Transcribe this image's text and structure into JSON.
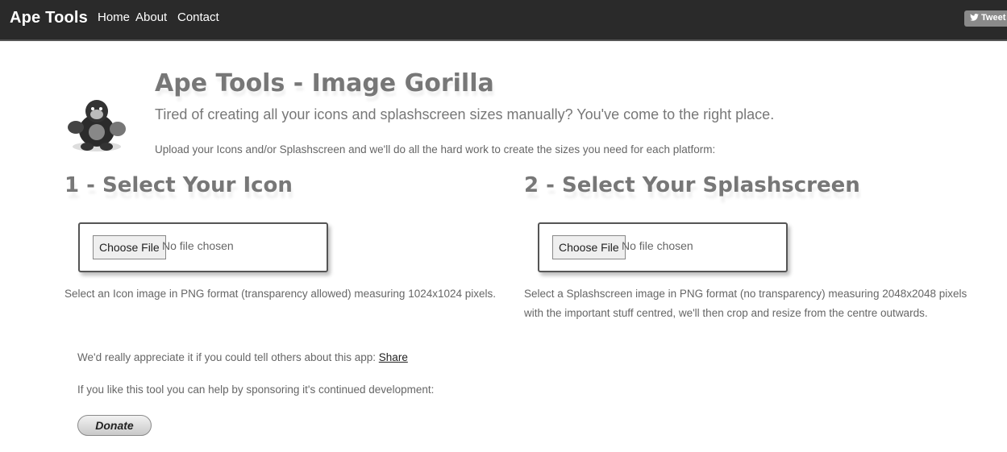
{
  "nav": {
    "brand": "Ape Tools",
    "links": [
      "Home",
      "About",
      "Contact"
    ],
    "tweet_label": "Tweet"
  },
  "header": {
    "title": "Ape Tools - Image Gorilla",
    "subtitle": "Tired of creating all your icons and splashscreen sizes manually? You've come to the right place.",
    "intro": "Upload your Icons and/or Splashscreen and we'll do all the hard work to create the sizes you need for each platform:"
  },
  "icon_section": {
    "title": "1 - Select Your Icon",
    "choose_label": "Choose File",
    "file_status": "No file chosen",
    "help": "Select an Icon image in PNG format (transparency allowed) measuring 1024x1024 pixels."
  },
  "splash_section": {
    "title": "2 - Select Your Splashscreen",
    "choose_label": "Choose File",
    "file_status": "No file chosen",
    "help_line1": "Select a Splashscreen image in PNG format (no transparency) measuring 2048x2048 pixels",
    "help_line2": "with the important stuff centred, we'll then crop and resize from the centre outwards."
  },
  "footer": {
    "share_text": "We'd really appreciate it if you could tell others about this app: ",
    "share_link": "Share",
    "sponsor_text": "If you like this tool you can help by sponsoring it's continued development:",
    "donate_label": "Donate"
  },
  "icons": {
    "logo": "gorilla-logo",
    "tweet": "twitter-bird-icon"
  }
}
